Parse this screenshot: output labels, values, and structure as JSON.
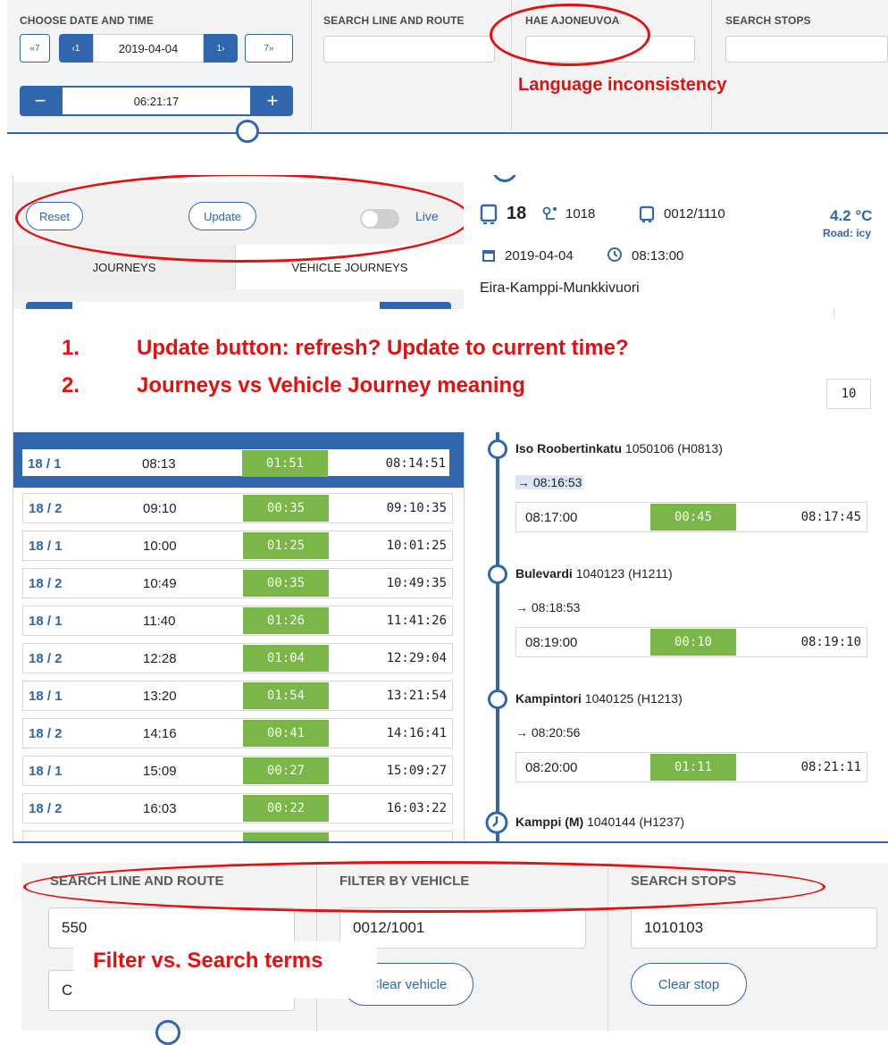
{
  "panel1": {
    "headers": {
      "date_time": "CHOOSE DATE AND TIME",
      "line_route": "SEARCH LINE AND ROUTE",
      "vehicle": "HAE AJONEUVOA",
      "stops": "SEARCH STOPS"
    },
    "date_controls": {
      "back7": "«7",
      "back1": "‹1",
      "date": "2019-04-04",
      "fwd1": "1›",
      "fwd7": "7»"
    },
    "time_controls": {
      "minus": "−",
      "time": "06:21:17",
      "plus": "+"
    },
    "annotation": "Language inconsistency"
  },
  "panel2": {
    "controls": {
      "reset": "Reset",
      "update": "Update",
      "live": "Live"
    },
    "tabs": {
      "journeys": "JOURNEYS",
      "vehicle_journeys": "VEHICLE JOURNEYS"
    },
    "annotation": {
      "n1": "1.",
      "line1": "Update button: refresh? Update to current time?",
      "n2": "2.",
      "line2": "Journeys vs Vehicle Journey meaning"
    },
    "right_header": {
      "route": "18",
      "stop_count": "1018",
      "vehicle": "0012/1110",
      "temperature": "4.2 °C",
      "road": "Road: icy",
      "date": "2019-04-04",
      "time": "08:13:00",
      "route_name": "Eira-Kamppi-Munkkivuori",
      "stray_value": "10"
    },
    "journeys": [
      {
        "route": "18 / 1",
        "planned": "08:13",
        "diff": "01:51",
        "observed": "08:14:51"
      },
      {
        "route": "18 / 2",
        "planned": "09:10",
        "diff": "00:35",
        "observed": "09:10:35"
      },
      {
        "route": "18 / 1",
        "planned": "10:00",
        "diff": "01:25",
        "observed": "10:01:25"
      },
      {
        "route": "18 / 2",
        "planned": "10:49",
        "diff": "00:35",
        "observed": "10:49:35"
      },
      {
        "route": "18 / 1",
        "planned": "11:40",
        "diff": "01:26",
        "observed": "11:41:26"
      },
      {
        "route": "18 / 2",
        "planned": "12:28",
        "diff": "01:04",
        "observed": "12:29:04"
      },
      {
        "route": "18 / 1",
        "planned": "13:20",
        "diff": "01:54",
        "observed": "13:21:54"
      },
      {
        "route": "18 / 2",
        "planned": "14:16",
        "diff": "00:41",
        "observed": "14:16:41"
      },
      {
        "route": "18 / 1",
        "planned": "15:09",
        "diff": "00:27",
        "observed": "15:09:27"
      },
      {
        "route": "18 / 2",
        "planned": "16:03",
        "diff": "00:22",
        "observed": "16:03:22"
      }
    ],
    "stops": [
      {
        "name": "Iso Roobertinkatu",
        "ids": "1050106 (H0813)",
        "arrival": "→ 08:16:53",
        "planned": "08:17:00",
        "diff": "00:45",
        "observed": "08:17:45"
      },
      {
        "name": "Bulevardi",
        "ids": "1040123 (H1211)",
        "arrival": "→ 08:18:53",
        "planned": "08:19:00",
        "diff": "00:10",
        "observed": "08:19:10"
      },
      {
        "name": "Kampintori",
        "ids": "1040125 (H1213)",
        "arrival": "→ 08:20:56",
        "planned": "08:20:00",
        "diff": "01:11",
        "observed": "08:21:11"
      }
    ],
    "last_stop": {
      "name": "Kamppi (M)",
      "ids": "1040144 (H1237)"
    }
  },
  "panel3": {
    "headers": {
      "line_route": "SEARCH LINE AND ROUTE",
      "vehicle": "FILTER BY VEHICLE",
      "stops": "SEARCH STOPS"
    },
    "line_value": "550",
    "route_value": "C",
    "vehicle_value": "0012/1001",
    "stop_value": "1010103",
    "clear_vehicle": "Clear vehicle",
    "clear_stop": "Clear stop",
    "annotation": "Filter vs. Search terms"
  },
  "colors": {
    "brand_blue": "#2f66ad",
    "diff_green": "#7ab648",
    "annotation_red": "#e31010"
  }
}
